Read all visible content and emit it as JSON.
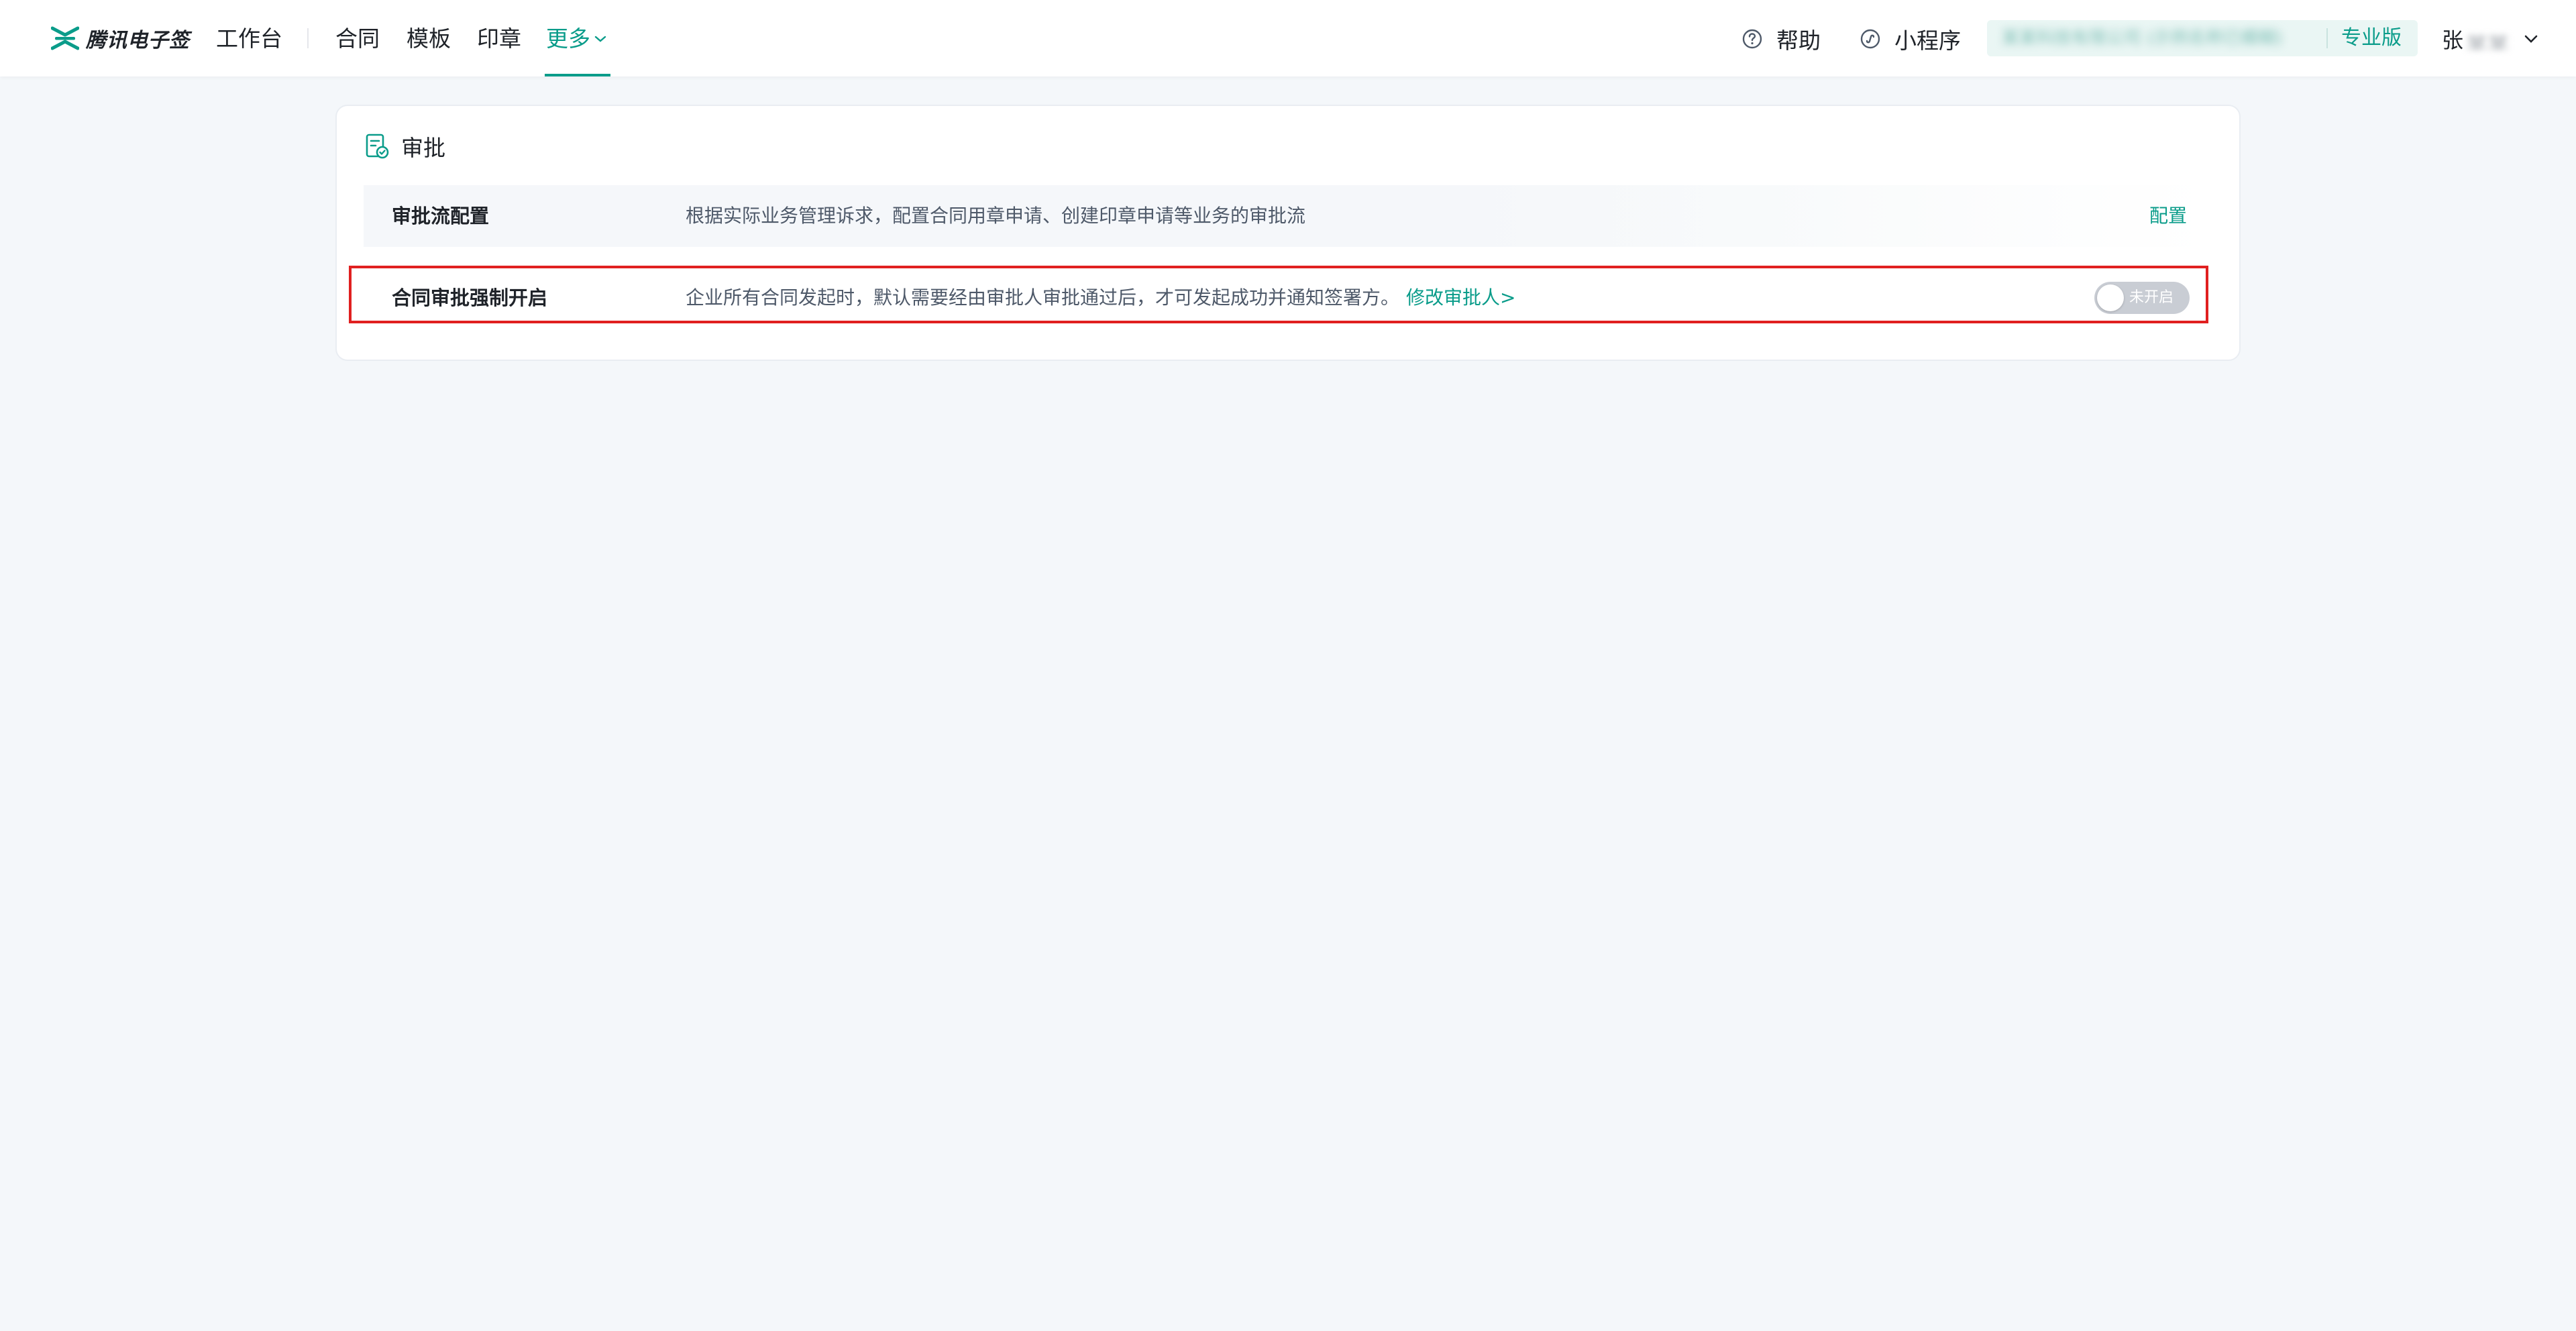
{
  "nav": {
    "logo_text": "腾讯电子签",
    "workbench": "工作台",
    "contract": "合同",
    "template": "模板",
    "seal": "印章",
    "more": "更多"
  },
  "tools": {
    "help": "帮助",
    "mini_program": "小程序"
  },
  "org": {
    "name": "某某科技有限公司 (示例名称已模糊)",
    "tier": "专业版"
  },
  "user": {
    "name_visible": "张",
    "name_hidden": "某某"
  },
  "card": {
    "title": "审批",
    "rows": [
      {
        "label": "审批流配置",
        "description": "根据实际业务管理诉求，配置合同用章申请、创建印章申请等业务的审批流",
        "action": "配置"
      },
      {
        "label": "合同审批强制开启",
        "description": "企业所有合同发起时，默认需要经由审批人审批通过后，才可发起成功并通知签署方。",
        "link": "修改审批人>",
        "toggle_state": "未开启"
      }
    ]
  },
  "colors": {
    "accent": "#0a9c8a",
    "background": "#f4f7fa",
    "highlight_border": "#e02020"
  }
}
